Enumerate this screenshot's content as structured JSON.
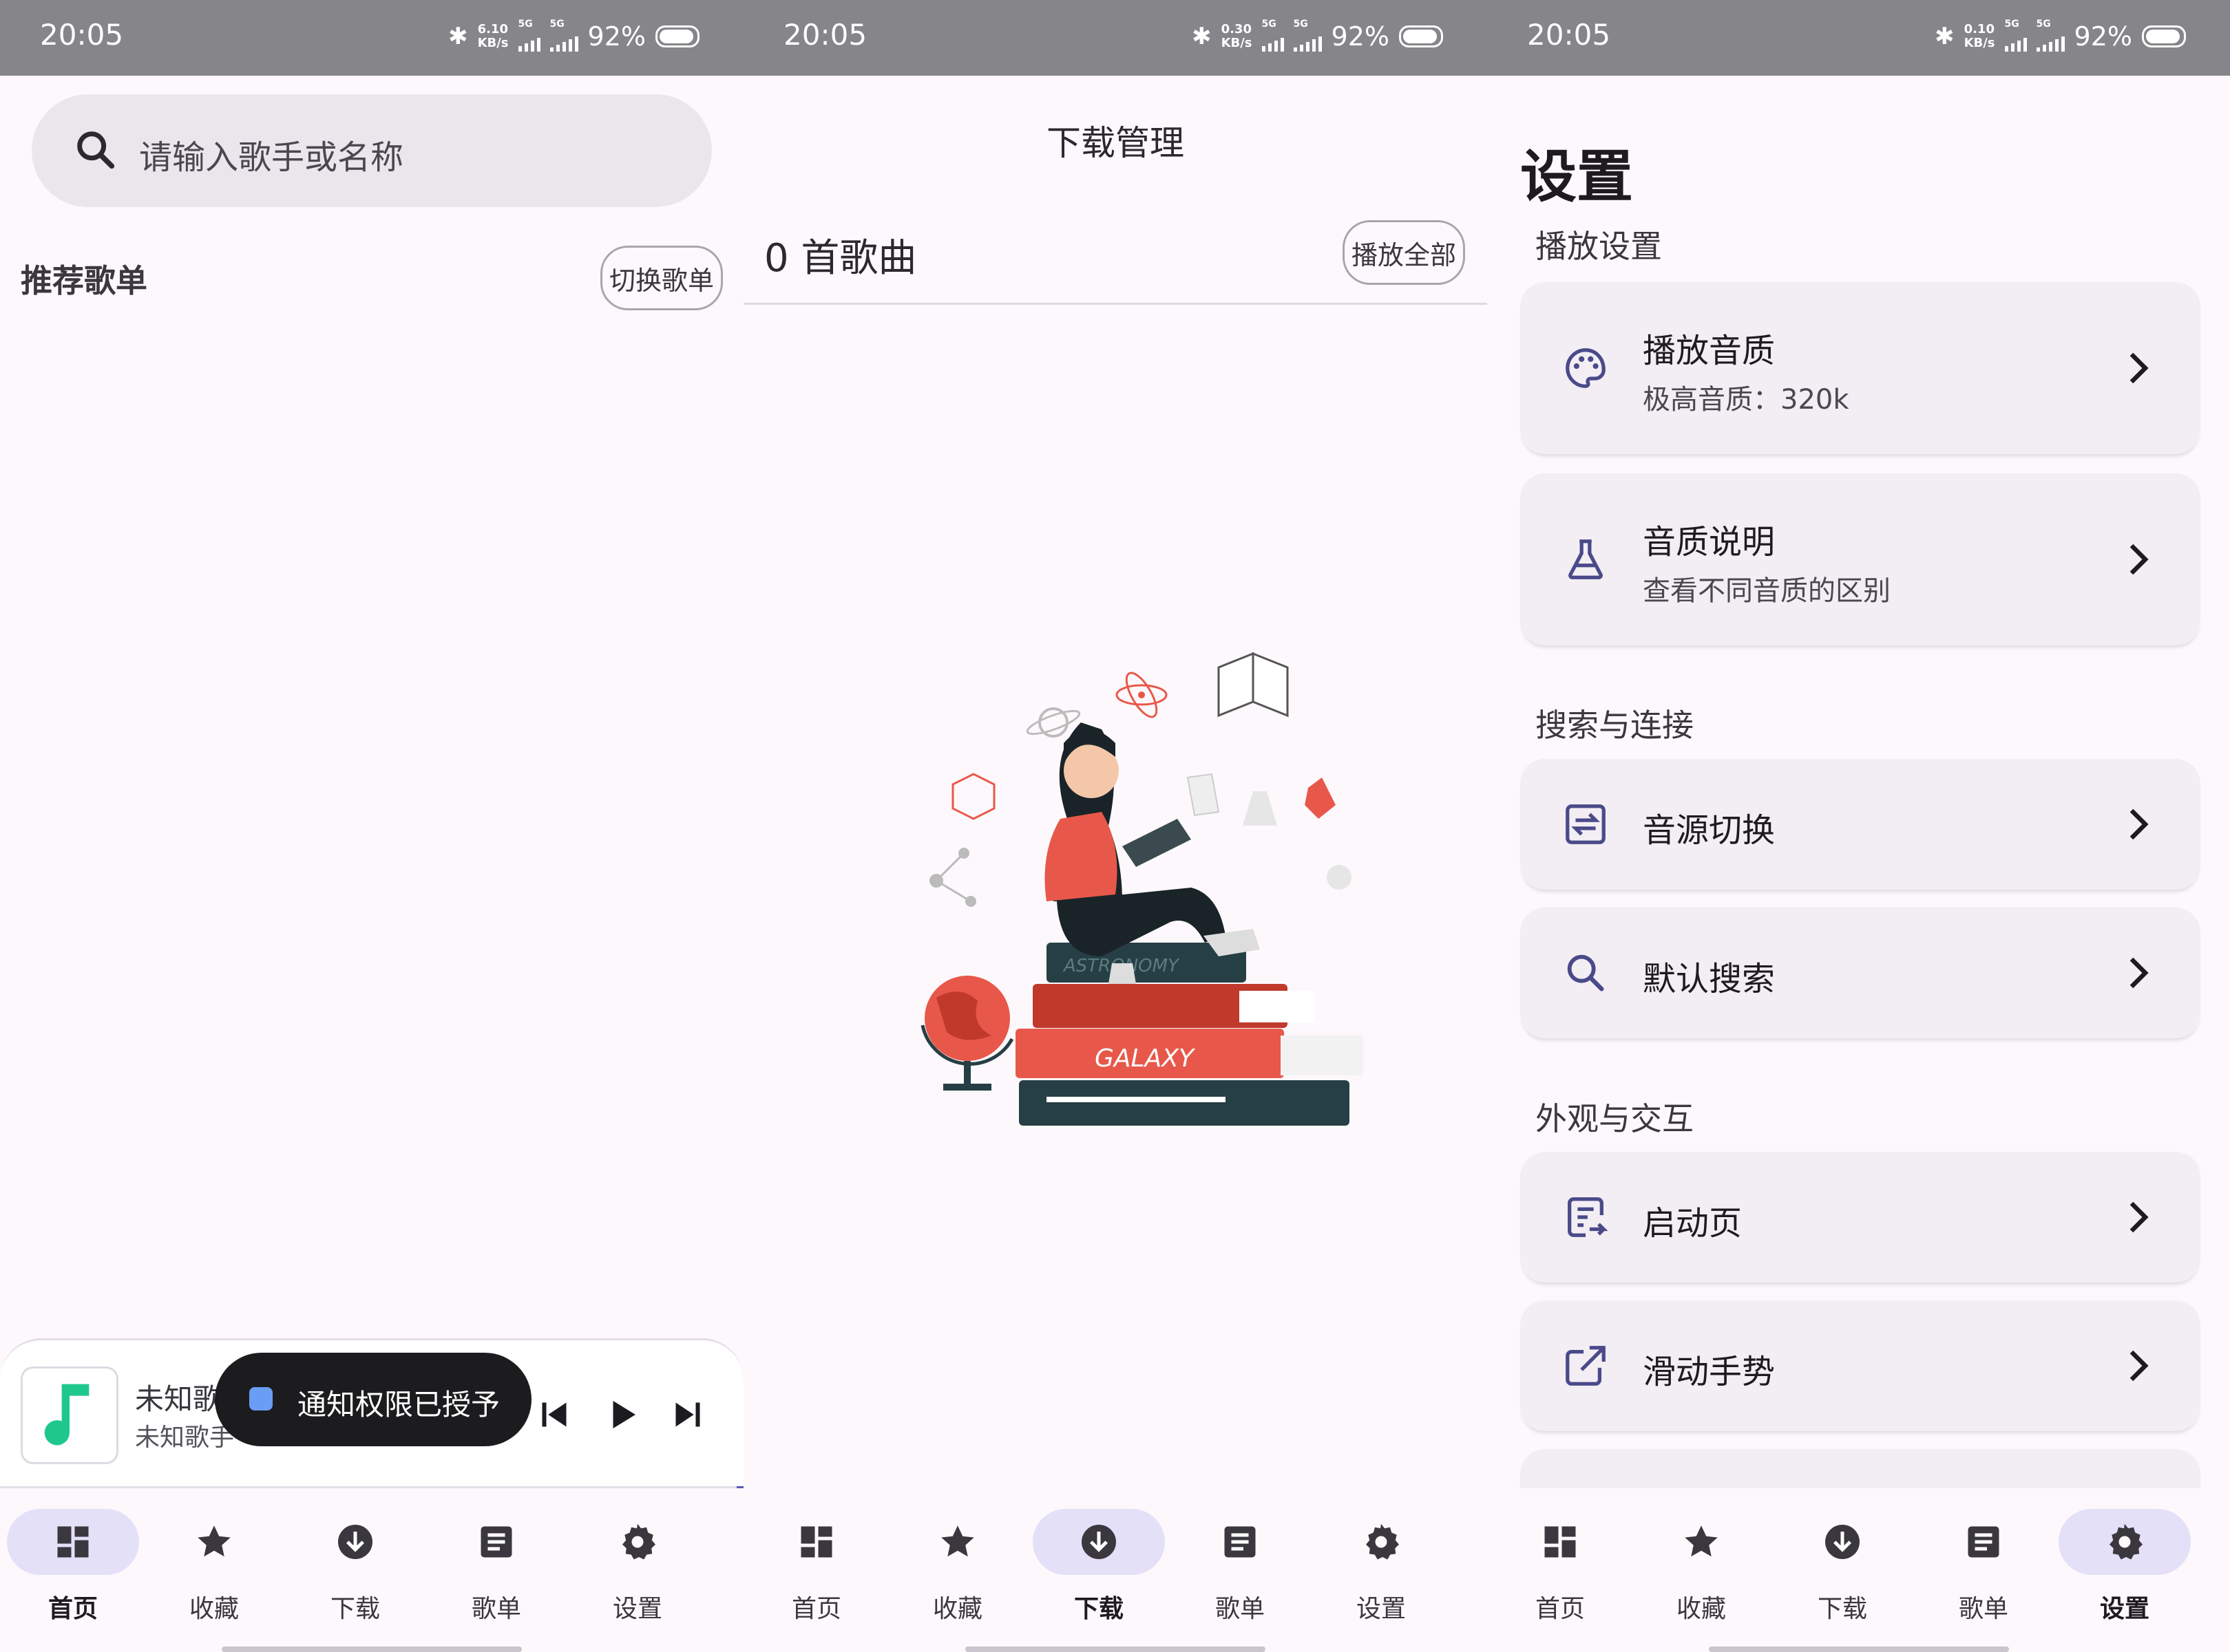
{
  "status_bars": [
    {
      "time": "20:05",
      "speed_top": "6.10",
      "speed_bottom": "KB/s",
      "sig1": "5G",
      "sig2": "5G",
      "battery": "92%"
    },
    {
      "time": "20:05",
      "speed_top": "0.30",
      "speed_bottom": "KB/s",
      "sig1": "5G",
      "sig2": "5G",
      "battery": "92%"
    },
    {
      "time": "20:05",
      "speed_top": "0.10",
      "speed_bottom": "KB/s",
      "sig1": "5G",
      "sig2": "5G",
      "battery": "92%"
    }
  ],
  "home": {
    "search_placeholder": "请输入歌手或名称",
    "recommend_title": "推荐歌单",
    "switch_button": "切换歌单",
    "mini_player": {
      "title": "未知歌",
      "subtitle": "未知歌手"
    },
    "toast": "通知权限已授予"
  },
  "downloads": {
    "title": "下载管理",
    "count": "0 首歌曲",
    "play_all": "播放全部",
    "illustration_books": [
      "ASTRONOMY",
      "GALAXY"
    ]
  },
  "settings": {
    "title": "设置",
    "sections": [
      {
        "header": "播放设置",
        "items": [
          {
            "icon": "palette-icon",
            "title": "播放音质",
            "subtitle": "极高音质：320k"
          },
          {
            "icon": "flask-icon",
            "title": "音质说明",
            "subtitle": "查看不同音质的区别"
          }
        ]
      },
      {
        "header": "搜索与连接",
        "items": [
          {
            "icon": "swap-icon",
            "title": "音源切换"
          },
          {
            "icon": "search-icon",
            "title": "默认搜索"
          }
        ]
      },
      {
        "header": "外观与交互",
        "items": [
          {
            "icon": "launch-page-icon",
            "title": "启动页"
          },
          {
            "icon": "open-in-new-icon",
            "title": "滑动手势"
          }
        ]
      }
    ]
  },
  "nav": {
    "labels": [
      "首页",
      "收藏",
      "下载",
      "歌单",
      "设置"
    ],
    "active_per_screen": [
      "首页",
      "下载",
      "设置"
    ]
  },
  "colors": {
    "accent": "#5a57b8",
    "active_pill": "#e4e0f8",
    "status_bar": "#868589",
    "note_green": "#1ec88c",
    "illustration_red": "#e8584a"
  }
}
